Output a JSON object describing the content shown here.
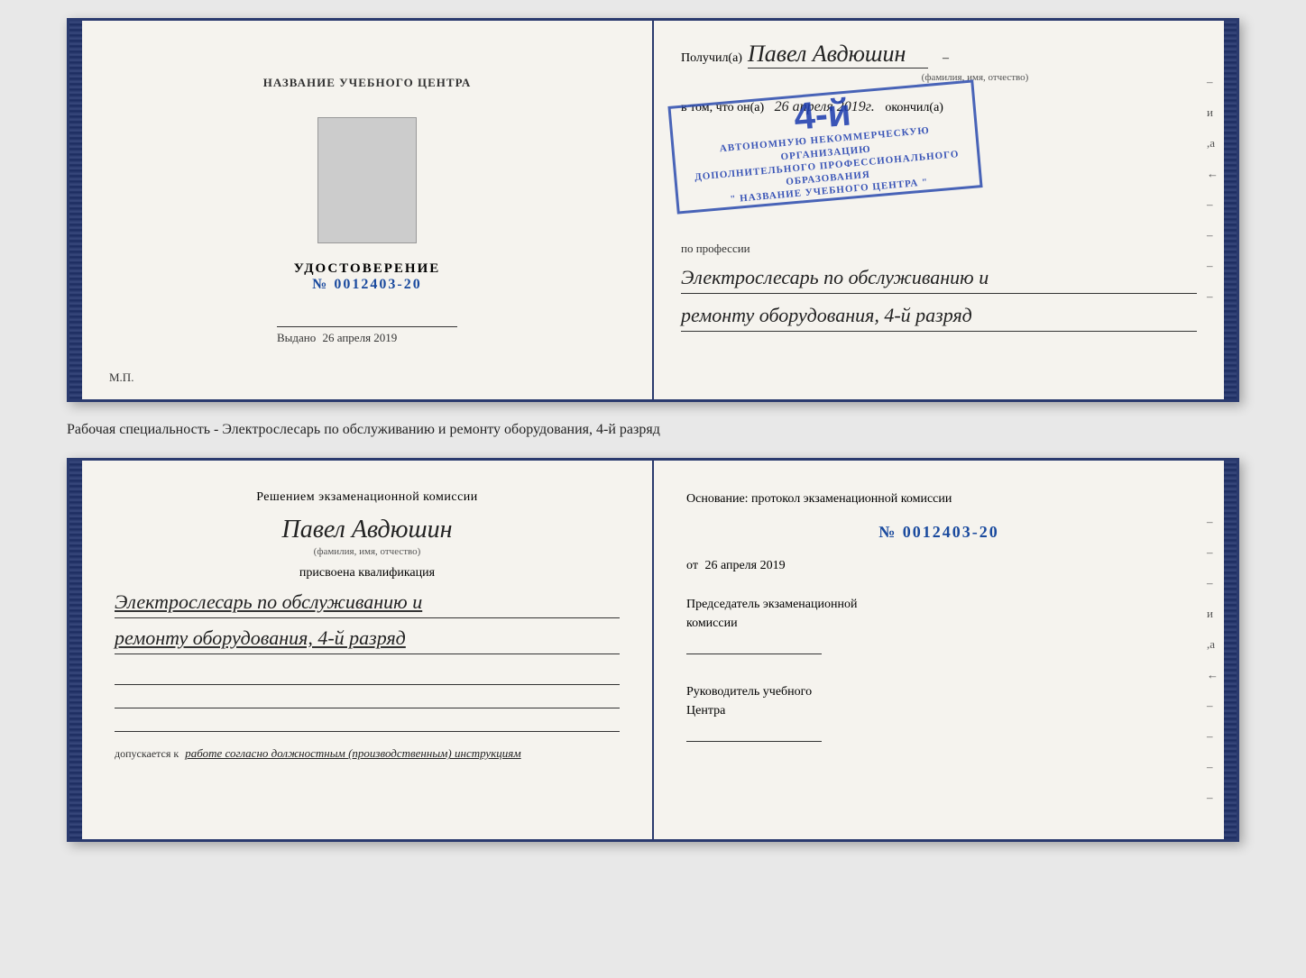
{
  "top_book": {
    "left_page": {
      "center_title": "НАЗВАНИЕ УЧЕБНОГО ЦЕНТРА",
      "udost_title": "УДОСТОВЕРЕНИЕ",
      "udost_number": "№ 0012403-20",
      "vydano_label": "Выдано",
      "vydano_date": "26 апреля 2019",
      "mp_label": "М.П."
    },
    "right_page": {
      "poluchil_label": "Получил(a)",
      "full_name": "Павел Авдюшин",
      "fio_label": "(фамилия, имя, отчество)",
      "vtom_prefix": "в том, что он(а)",
      "date_handwritten": "26 апреля 2019г.",
      "okonchil_label": "окончил(а)",
      "stamp_line1": "АВТОНОМНУЮ НЕКОММЕРЧЕСКУЮ ОРГАНИЗАЦИЮ",
      "stamp_line2": "ДОПОЛНИТЕЛЬНОГО ПРОФЕССИОНАЛЬНОГО ОБРАЗОВАНИЯ",
      "stamp_line3": "\" НАЗВАНИЕ УЧЕБНОГО ЦЕНТРА \"",
      "stamp_big": "4-й",
      "po_professii_label": "по профессии",
      "profession_line1": "Электрослесарь по обслуживанию и",
      "profession_line2": "ремонту оборудования, 4-й разряд",
      "edge_marks": [
        "-",
        "и",
        ",а",
        "←",
        "-",
        "-",
        "-",
        "-"
      ]
    }
  },
  "between_text": "Рабочая специальность - Электрослесарь по обслуживанию и ремонту оборудования, 4-й разряд",
  "bottom_book": {
    "left_page": {
      "resheniem_title": "Решением экзаменационной  комиссии",
      "full_name": "Павел Авдюшин",
      "fio_label": "(фамилия, имя, отчество)",
      "prisvoena_text": "присвоена квалификация",
      "qual_line1": "Электрослесарь по обслуживанию и",
      "qual_line2": "ремонту оборудования, 4-й разряд",
      "dopuskaetsya_prefix": "допускается к",
      "dopuskaetsya_text": "работе согласно должностным (производственным) инструкциям"
    },
    "right_page": {
      "osnov_label": "Основание: протокол экзаменационной  комиссии",
      "prot_number": "№  0012403-20",
      "ot_label": "от",
      "ot_date": "26 апреля 2019",
      "predsed_line1": "Председатель экзаменационной",
      "predsed_line2": "комиссии",
      "rukov_line1": "Руководитель учебного",
      "rukov_line2": "Центра",
      "edge_marks": [
        "-",
        "-",
        "-",
        "и",
        ",а",
        "←",
        "-",
        "-",
        "-",
        "-"
      ]
    }
  }
}
